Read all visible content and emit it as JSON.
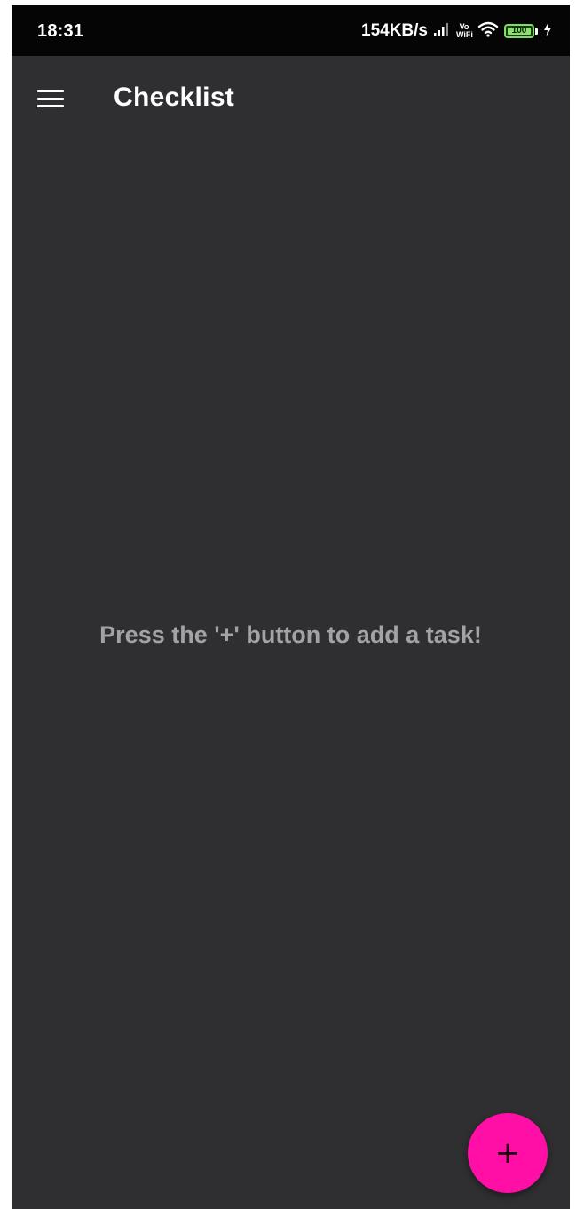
{
  "status_bar": {
    "time": "18:31",
    "net_speed": "154KB/s",
    "vowifi_top": "Vo",
    "vowifi_bottom": "WiFi",
    "battery_level": "100",
    "icons": [
      "signal-icon",
      "wifi-icon",
      "battery-icon",
      "charging-icon"
    ]
  },
  "app_bar": {
    "title": "Checklist",
    "menu_icon": "hamburger-menu-icon"
  },
  "main": {
    "empty_message": "Press the '+' button to add a task!"
  },
  "fab": {
    "icon": "+",
    "color": "#ff0fa6"
  },
  "colors": {
    "background": "#2f2f31",
    "status_bar": "#050505",
    "accent": "#ff0fa6",
    "battery": "#8ae16f"
  }
}
